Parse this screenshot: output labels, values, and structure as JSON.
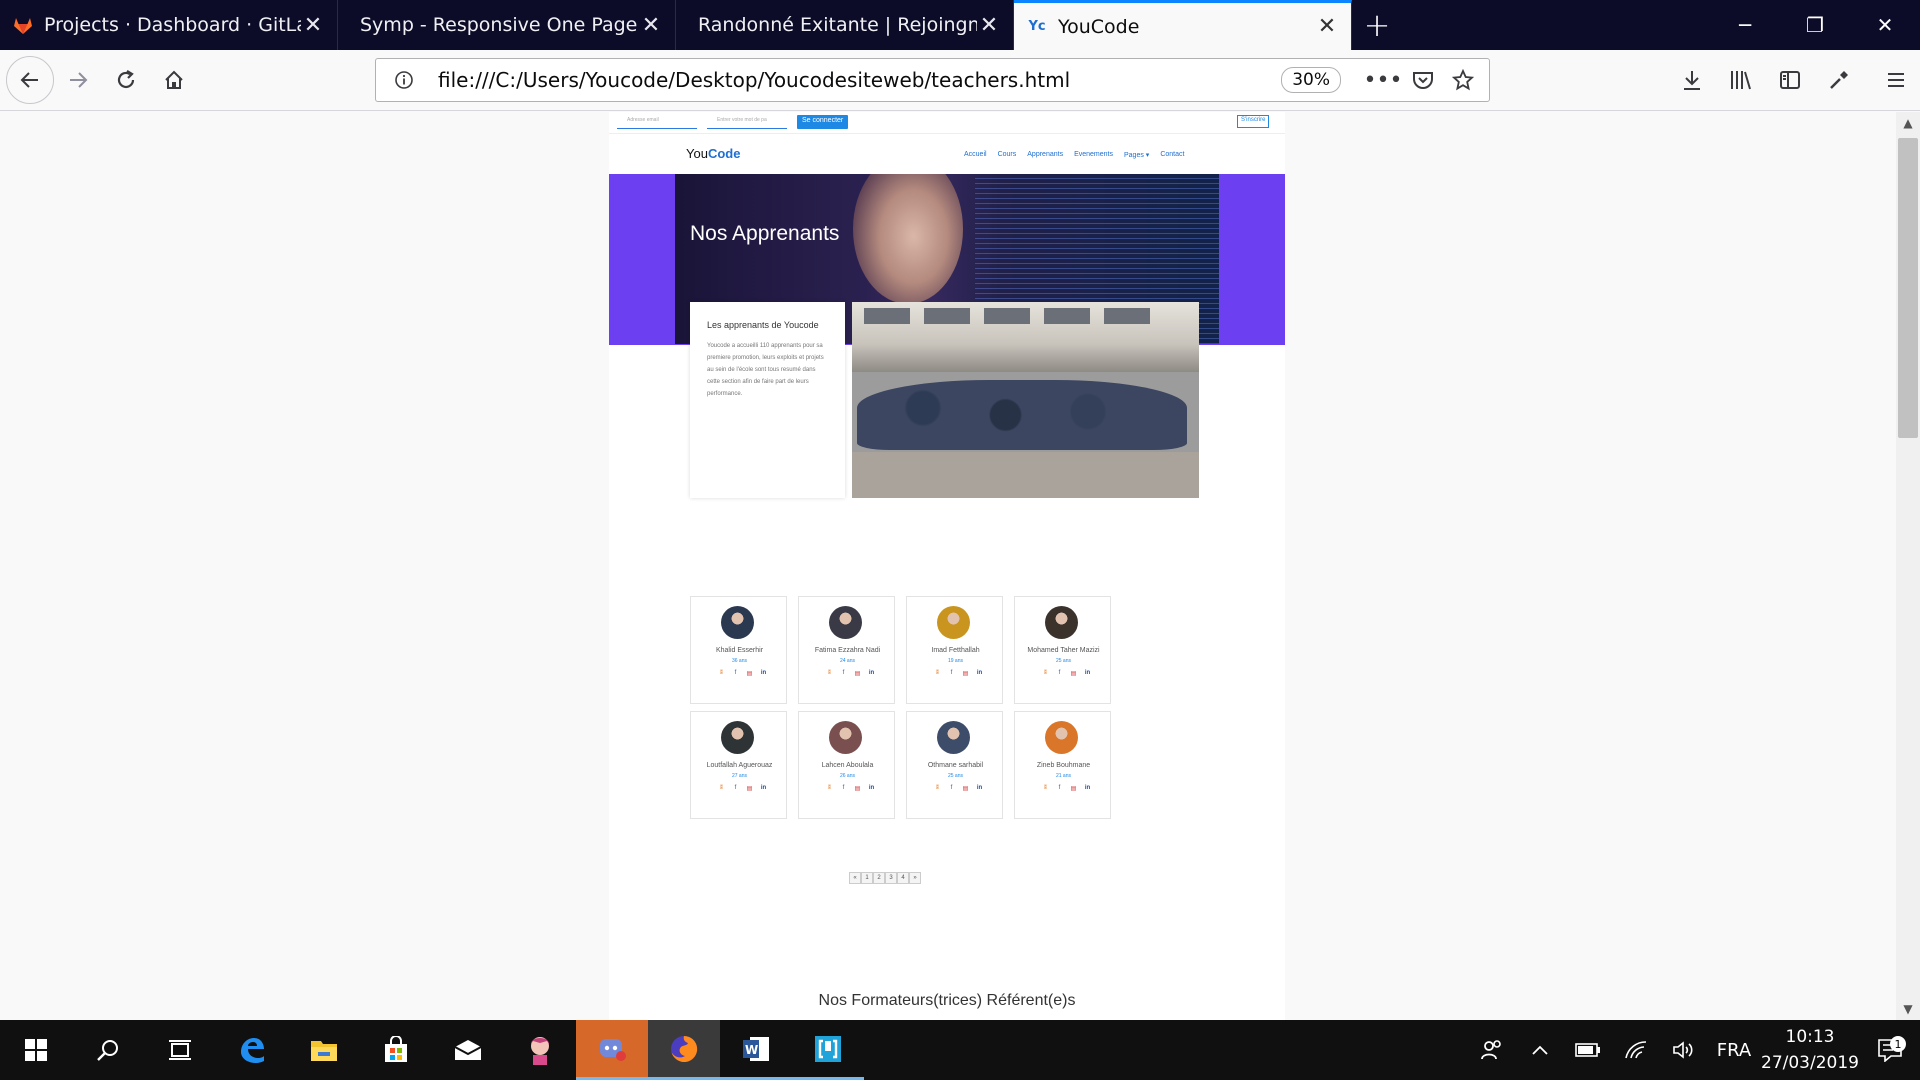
{
  "browser": {
    "tabs": [
      {
        "title": "Projects · Dashboard · GitLab",
        "icon": "gitlab-icon",
        "active": false
      },
      {
        "title": "Symp - Responsive One Page VCard",
        "icon": "none",
        "active": false
      },
      {
        "title": "Randonné Exitante | Rejoingnez l'av",
        "icon": "none",
        "active": false
      },
      {
        "title": "YouCode",
        "icon": "youcode-icon",
        "active": true
      }
    ],
    "url": "file:///C:/Users/Youcode/Desktop/Youcodesiteweb/teachers.html",
    "zoom": "30%"
  },
  "site": {
    "login": {
      "email_placeholder": "Adresse email",
      "password_placeholder": "Entrer votre mot de pa",
      "login_button": "Se connecter",
      "signup_button": "S'inscrire"
    },
    "logo": {
      "you": "You",
      "code": "Code"
    },
    "menu": [
      "Accueil",
      "Cours",
      "Apprenants",
      "Evenements",
      "Pages ▾",
      "Contact"
    ],
    "hero_title": "Nos Apprenants",
    "intro": {
      "heading": "Les apprenants de Youcode",
      "text": "Youcode a accueilli 110 apprenants pour sa premiere promotion, leurs exploits et projets au sein de l'école sont tous resumé dans cette section afin de faire part de leurs performance."
    },
    "students": [
      {
        "name": "Khalid Esserhir",
        "age": "36 ans",
        "avatar_color": "#2a3850"
      },
      {
        "name": "Fatima Ezzahra Nadi",
        "age": "24 ans",
        "avatar_color": "#3a3a46"
      },
      {
        "name": "Imad Fetthallah",
        "age": "19 ans",
        "avatar_color": "#c9951e"
      },
      {
        "name": "Mohamed Taher Mazizi",
        "age": "25 ans",
        "avatar_color": "#3b322c"
      },
      {
        "name": "Loutfallah Aguerouaz",
        "age": "27 ans",
        "avatar_color": "#2e3436"
      },
      {
        "name": "Lahcen Aboulala",
        "age": "26 ans",
        "avatar_color": "#7a4f4f"
      },
      {
        "name": "Othmane sarhabil",
        "age": "25 ans",
        "avatar_color": "#3d4c68"
      },
      {
        "name": "Zineb Bouhmane",
        "age": "21 ans",
        "avatar_color": "#d9762a"
      }
    ],
    "social_icons": [
      "gitlab-icon",
      "facebook-icon",
      "cv-icon",
      "linkedin-icon"
    ],
    "pagination": [
      "«",
      "1",
      "2",
      "3",
      "4",
      "»"
    ],
    "formateurs_title": "Nos Formateurs(trices) Référent(e)s"
  },
  "taskbar": {
    "apps": [
      "start-icon",
      "search-icon",
      "task-view-icon",
      "edge-icon",
      "file-explorer-icon",
      "store-icon",
      "mail-icon",
      "anime-app-icon",
      "discord-icon",
      "firefox-icon",
      "word-icon",
      "bracket-app-icon"
    ],
    "language": "FRA",
    "time": "10:13",
    "date": "27/03/2019",
    "notifications": "1"
  },
  "colors": {
    "accent": "#0a84ff",
    "hero_purple": "#6c3ff0",
    "site_blue": "#1e88e5"
  }
}
